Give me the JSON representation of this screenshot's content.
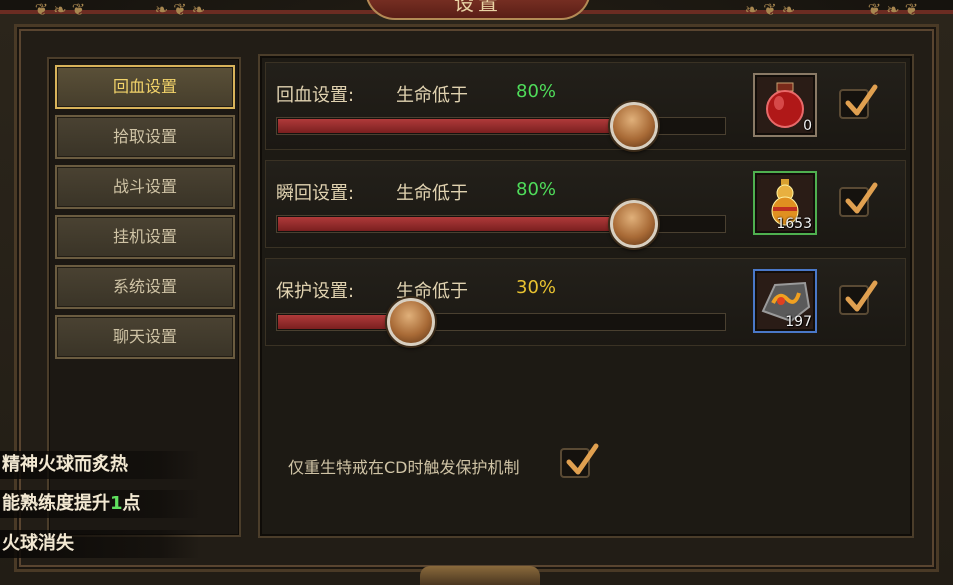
{
  "window": {
    "title": "设置"
  },
  "menu": {
    "items": [
      {
        "label": "回血设置",
        "active": true
      },
      {
        "label": "拾取设置",
        "active": false
      },
      {
        "label": "战斗设置",
        "active": false
      },
      {
        "label": "挂机设置",
        "active": false
      },
      {
        "label": "系统设置",
        "active": false
      },
      {
        "label": "聊天设置",
        "active": false
      }
    ]
  },
  "rows": [
    {
      "label": "回血设置:",
      "condition": "生命低于",
      "percent_text": "80%",
      "percent_color": "#4fdc5a",
      "value": 0.8,
      "item_icon": "red-potion-icon",
      "item_count": "0",
      "item_border": "default",
      "checked": true
    },
    {
      "label": "瞬回设置:",
      "condition": "生命低于",
      "percent_text": "80%",
      "percent_color": "#4fdc5a",
      "value": 0.8,
      "item_icon": "golden-gourd-icon",
      "item_count": "1653",
      "item_border": "green",
      "checked": true
    },
    {
      "label": "保护设置:",
      "condition": "生命低于",
      "percent_text": "30%",
      "percent_color": "#e8c230",
      "value": 0.3,
      "item_icon": "rune-stone-icon",
      "item_count": "197",
      "item_border": "blue",
      "checked": true
    }
  ],
  "footnote": {
    "label": "仅重生特戒在CD时触发保护机制",
    "checked": true
  },
  "chat": {
    "lines": [
      {
        "prefix": "精神火球而炙热",
        "highlight": "",
        "suffix": ""
      },
      {
        "prefix": "能熟练度提升",
        "highlight": "1",
        "suffix": "点"
      },
      {
        "prefix": "火球消失",
        "highlight": "",
        "suffix": ""
      }
    ]
  },
  "colors": {
    "accent_gold": "#f2d36a",
    "slider_fill": "#b03a3a",
    "checkmark": "#e0a050"
  }
}
